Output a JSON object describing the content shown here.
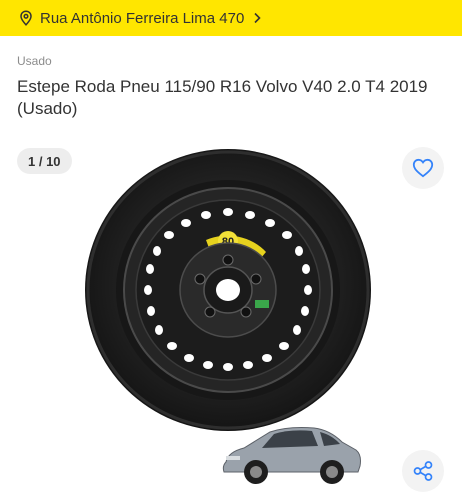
{
  "location": {
    "address": "Rua Antônio Ferreira Lima 470",
    "pin_icon": "location-pin-icon",
    "chevron_icon": "chevron-right-icon",
    "bar_color": "#ffe600"
  },
  "listing": {
    "condition": "Usado",
    "title": "Estepe Roda Pneu 115/90 R16 Volvo V40 2.0 T4 2019 (Usado)"
  },
  "gallery": {
    "counter": "1 / 10",
    "favorite_icon": "heart-icon",
    "share_icon": "share-icon",
    "accent_color": "#3483fa",
    "sticker_text": "80"
  }
}
